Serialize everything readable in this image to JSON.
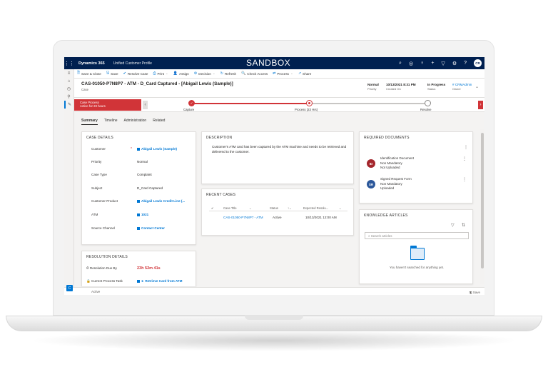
{
  "topbar": {
    "brand": "Dynamics 365",
    "app": "Unified Customer Profile",
    "env": "SANDBOX",
    "user_initials": "CR"
  },
  "commands": [
    {
      "icon": "save-close-icon",
      "label": "Save & Close",
      "symbol": "🗎"
    },
    {
      "icon": "save-icon",
      "label": "Save",
      "symbol": "🖫"
    },
    {
      "icon": "resolve-case-icon",
      "label": "Resolve Case",
      "symbol": "✔"
    },
    {
      "icon": "print-icon",
      "label": "Print",
      "symbol": "⎙"
    },
    {
      "icon": "assign-icon",
      "label": "Assign",
      "symbol": "👤"
    },
    {
      "icon": "decision-icon",
      "label": "Decision",
      "symbol": "⚙"
    },
    {
      "icon": "refresh-icon",
      "label": "Refresh",
      "symbol": "↻"
    },
    {
      "icon": "check-access-icon",
      "label": "Check Access",
      "symbol": "🔍"
    },
    {
      "icon": "process-icon",
      "label": "Process",
      "symbol": "⇄"
    },
    {
      "icon": "share-icon",
      "label": "Share",
      "symbol": "↗"
    }
  ],
  "header": {
    "title": "CAS-01050-P7N8P7 - ATM - D_Card Captured - [Abigail Lewis (Sample)]",
    "entity": "Case",
    "fields": [
      {
        "value": "Normal",
        "label": "Priority"
      },
      {
        "value": "10/13/2021 8:31 PM",
        "label": "Created On"
      },
      {
        "value": "In Progress",
        "label": "Status"
      },
      {
        "value": "# CRMAdmin",
        "label": "Owner"
      }
    ]
  },
  "bpf": {
    "active_stage": "Case Process",
    "active_sub": "Active for 23 hours",
    "stages": [
      {
        "label": "Capture"
      },
      {
        "label": "Process  (23 Hrs)"
      },
      {
        "label": "Resolve"
      }
    ]
  },
  "tabs": [
    "Summary",
    "Timeline",
    "Administration",
    "Related"
  ],
  "case_details": {
    "heading": "CASE DETAILS",
    "fields": [
      {
        "label": "Customer",
        "value": "Abigail Lewis (Sample)",
        "required": "*"
      },
      {
        "label": "Priority",
        "value": "Normal"
      },
      {
        "label": "Case Type",
        "value": "Complaint"
      },
      {
        "label": "Subject",
        "value": "D_Card Captured"
      },
      {
        "label": "Customer Product",
        "value": "Abigail Lewis Credit Line (..."
      },
      {
        "label": "ATM",
        "value": "1021"
      },
      {
        "label": "Source Channel",
        "value": "Contact Center"
      }
    ]
  },
  "resolution": {
    "heading": "RESOLUTION DETAILS",
    "due_label": "Resolution Due By",
    "due_value": "23h 52m 41s",
    "task_label": "Current Process Task",
    "task_value": "1- Retrieve Card from ATM"
  },
  "description": {
    "heading": "DESCRIPTION",
    "text": "Customer's ATM card has been captured by the ATM machine and needs to be retrieved and delivered to the customer."
  },
  "recent_cases": {
    "heading": "RECENT CASES",
    "columns": [
      "Case Title",
      "Status",
      "Expected Resolu..."
    ],
    "rows": [
      {
        "title": "CAS-01050-P7N8P7 - ATM",
        "status": "Active",
        "date": "10/13/2021 12:00 AM"
      }
    ]
  },
  "required_docs": {
    "heading": "REQUIRED DOCUMENTS",
    "items": [
      {
        "initials": "ID",
        "color": "#a4262c",
        "name": "Identification Document",
        "line2": "Non Mandatory",
        "line3": "Not Uploaded"
      },
      {
        "initials": "SR",
        "color": "#2b579a",
        "name": "Signed Request Form",
        "line2": "Non Mandatory",
        "line3": "Uploaded"
      }
    ]
  },
  "knowledge": {
    "heading": "KNOWLEDGE ARTICLES",
    "placeholder": "Search articles",
    "empty": "You haven't searched for anything yet."
  },
  "statusbar": {
    "state": "Active",
    "save": "Save"
  }
}
